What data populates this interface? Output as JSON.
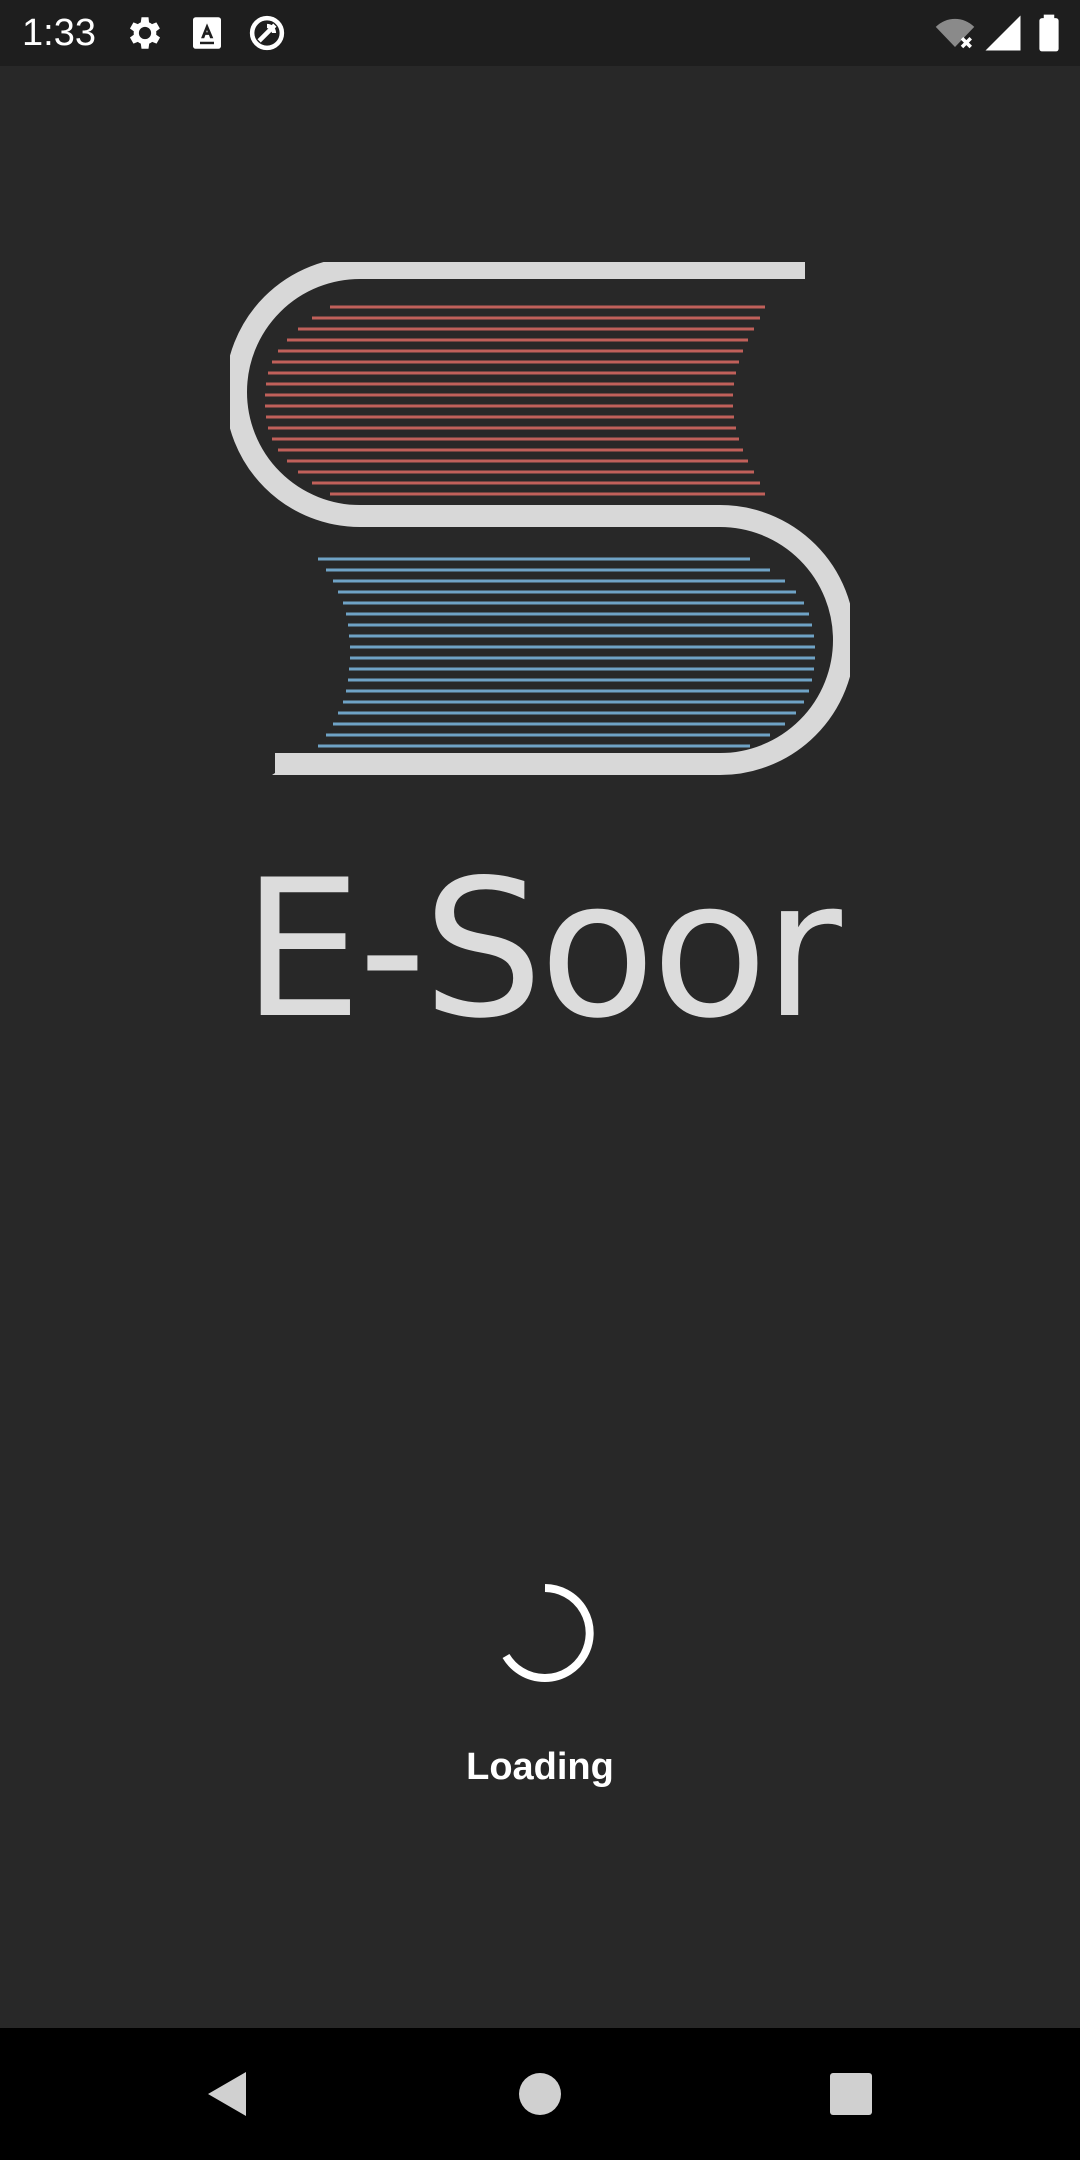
{
  "status_bar": {
    "time": "1:33",
    "icons": [
      "settings-icon",
      "keyboard-a-icon",
      "do-not-disturb-icon",
      "wifi-off-icon",
      "signal-icon",
      "battery-icon"
    ]
  },
  "splash": {
    "app_name": "E-Soor",
    "loading_text": "Loading"
  },
  "logo": {
    "colors": {
      "outline": "#d8d8d8",
      "top_lines": "#c0605a",
      "bottom_lines": "#6fa3c6"
    }
  },
  "colors": {
    "background": "#282828",
    "status_bar": "#1e1e1e",
    "nav_bar": "#000000",
    "text": "#ffffff"
  },
  "nav_bar": {
    "buttons": [
      "back-icon",
      "home-icon",
      "recents-icon"
    ]
  }
}
